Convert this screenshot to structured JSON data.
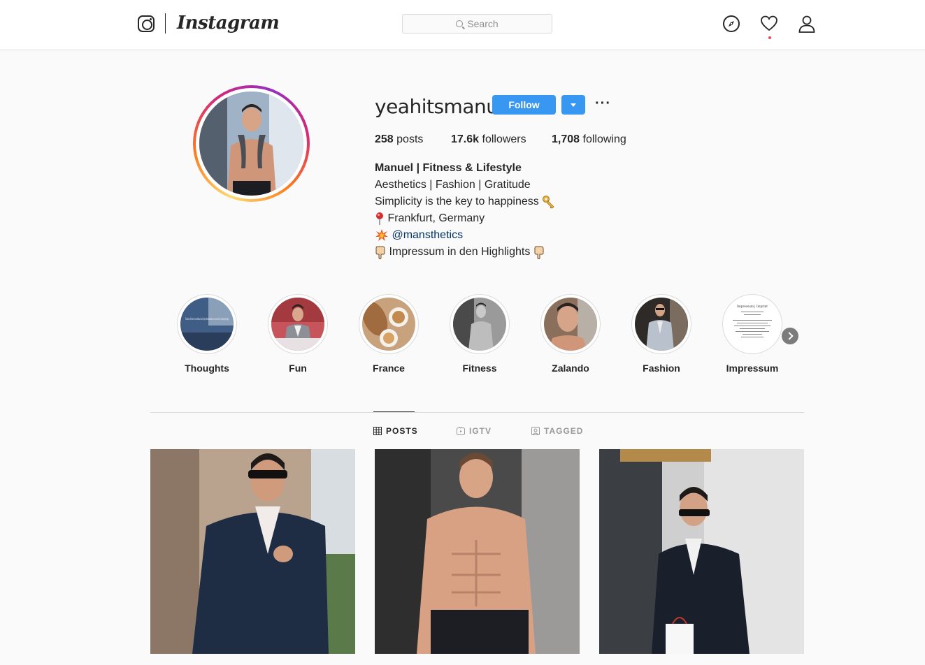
{
  "nav": {
    "brand": "Instagram",
    "search_placeholder": "Search"
  },
  "profile": {
    "username": "yeahitsmanu",
    "follow_label": "Follow",
    "more_label": "···",
    "stats": {
      "posts_count": "258",
      "posts_label": "posts",
      "followers_count": "17.6k",
      "followers_label": "followers",
      "following_count": "1,708",
      "following_label": "following"
    },
    "bio": {
      "name": "Manuel | Fitness & Lifestyle",
      "line1": "Aesthetics | Fashion | Gratitude",
      "line2": "Simplicity is the key to happiness",
      "line3": "Frankfurt, Germany",
      "line4_link": "@mansthetics",
      "line5": "Impressum in den Highlights"
    }
  },
  "highlights": [
    {
      "label": "Thoughts"
    },
    {
      "label": "Fun"
    },
    {
      "label": "France"
    },
    {
      "label": "Fitness"
    },
    {
      "label": "Zalando"
    },
    {
      "label": "Fashion"
    },
    {
      "label": "Impressum"
    }
  ],
  "highlight_thoughts_text": "Failure will never overtake me if my determination to succeed is strong enough",
  "highlight_impressum_title": "Impressum | Imprint",
  "tabs": [
    {
      "label": "POSTS",
      "icon": "grid-icon",
      "active": true
    },
    {
      "label": "IGTV",
      "icon": "igtv-icon",
      "active": false
    },
    {
      "label": "TAGGED",
      "icon": "tagged-icon",
      "active": false
    }
  ],
  "colors": {
    "accent": "#3897f0",
    "link": "#003569",
    "notification_dot": "#ed4956"
  }
}
